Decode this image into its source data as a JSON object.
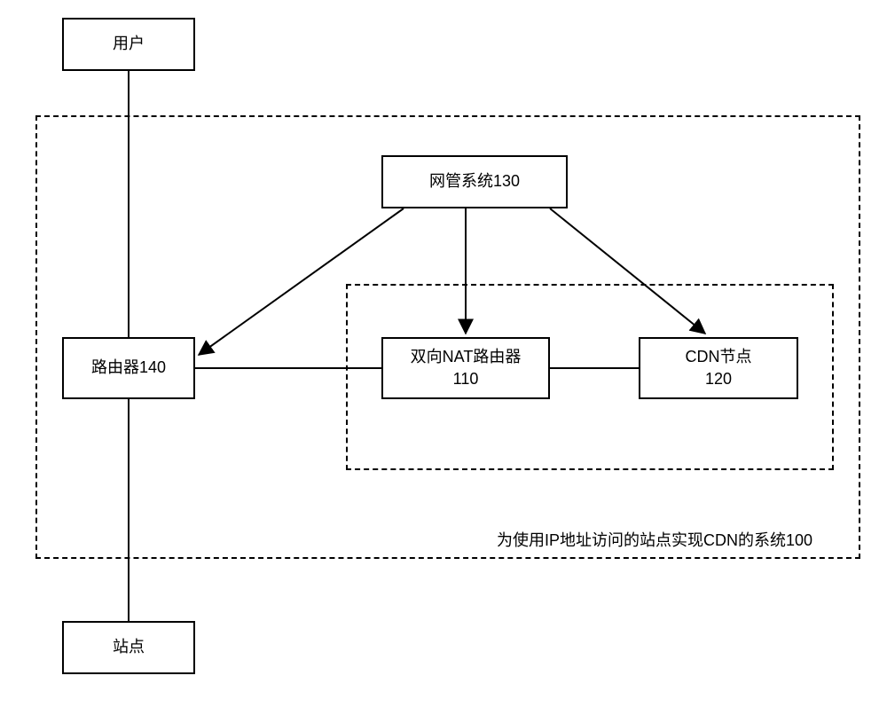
{
  "nodes": {
    "user": "用户",
    "site": "站点",
    "nms": "网管系统130",
    "router": "路由器140",
    "nat_router_line1": "双向NAT路由器",
    "nat_router_line2": "110",
    "cdn_node_line1": "CDN节点",
    "cdn_node_line2": "120",
    "system_label": "为使用IP地址访问的站点实现CDN的系统100"
  },
  "chart_data": {
    "type": "diagram",
    "title": "为使用IP地址访问的站点实现CDN的系统100",
    "nodes": [
      {
        "id": "user",
        "label": "用户"
      },
      {
        "id": "site",
        "label": "站点"
      },
      {
        "id": "system100",
        "label": "为使用IP地址访问的站点实现CDN的系统100",
        "style": "dashed-container"
      },
      {
        "id": "inner_box",
        "label": "",
        "style": "dashed-container",
        "parent": "system100"
      },
      {
        "id": "nms130",
        "label": "网管系统130",
        "parent": "system100"
      },
      {
        "id": "router140",
        "label": "路由器140",
        "parent": "system100"
      },
      {
        "id": "nat110",
        "label": "双向NAT路由器 110",
        "parent": "inner_box"
      },
      {
        "id": "cdn120",
        "label": "CDN节点 120",
        "parent": "inner_box"
      }
    ],
    "edges": [
      {
        "from": "user",
        "to": "router140",
        "directed": false
      },
      {
        "from": "router140",
        "to": "site",
        "directed": false
      },
      {
        "from": "router140",
        "to": "nat110",
        "directed": false
      },
      {
        "from": "nat110",
        "to": "cdn120",
        "directed": false
      },
      {
        "from": "nms130",
        "to": "router140",
        "directed": true
      },
      {
        "from": "nms130",
        "to": "nat110",
        "directed": true
      },
      {
        "from": "nms130",
        "to": "cdn120",
        "directed": true
      }
    ]
  }
}
